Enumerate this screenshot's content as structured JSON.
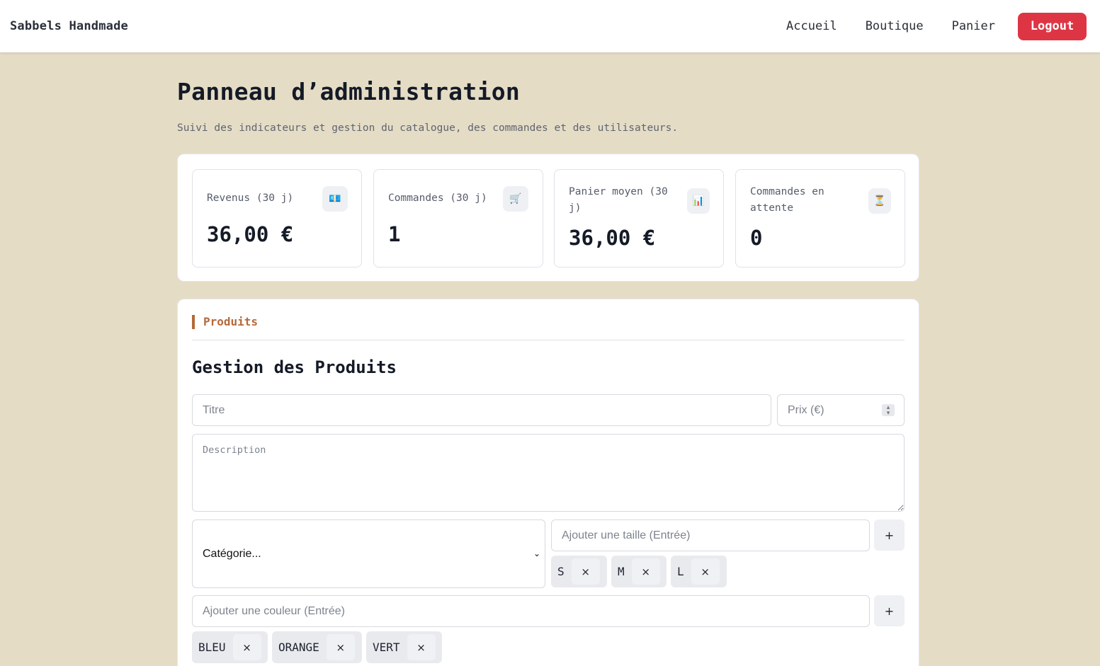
{
  "nav": {
    "brand": "Sabbels Handmade",
    "links": [
      "Accueil",
      "Boutique",
      "Panier"
    ],
    "logout_label": "Logout"
  },
  "page": {
    "title": "Panneau d’administration",
    "subtitle": "Suivi des indicateurs et gestion du catalogue, des commandes et des utilisateurs."
  },
  "stats": [
    {
      "label": "Revenus (30 j)",
      "value": "36,00 €",
      "icon": "money-icon",
      "glyph": "💶"
    },
    {
      "label": "Commandes (30 j)",
      "value": "1",
      "icon": "cart-icon",
      "glyph": "🛒"
    },
    {
      "label": "Panier moyen (30 j)",
      "value": "36,00 €",
      "icon": "bar-chart-icon",
      "glyph": "📊"
    },
    {
      "label": "Commandes en attente",
      "value": "0",
      "icon": "hourglass-icon",
      "glyph": "⏳"
    }
  ],
  "products": {
    "section_tab": "Produits",
    "heading": "Gestion des Produits",
    "title_placeholder": "Titre",
    "price_placeholder": "Prix (€)",
    "description_placeholder": "Description",
    "category_value": "Catégorie...",
    "size_placeholder": "Ajouter une taille (Entrée)",
    "sizes": [
      "S",
      "M",
      "L"
    ],
    "color_placeholder": "Ajouter une couleur (Entrée)",
    "colors": [
      "BLEU",
      "ORANGE",
      "VERT"
    ],
    "add_label": "+",
    "remove_label": "×"
  },
  "colors": {
    "background": "#e5dcc6",
    "accent": "#b46a3a",
    "logout": "#de3545"
  }
}
